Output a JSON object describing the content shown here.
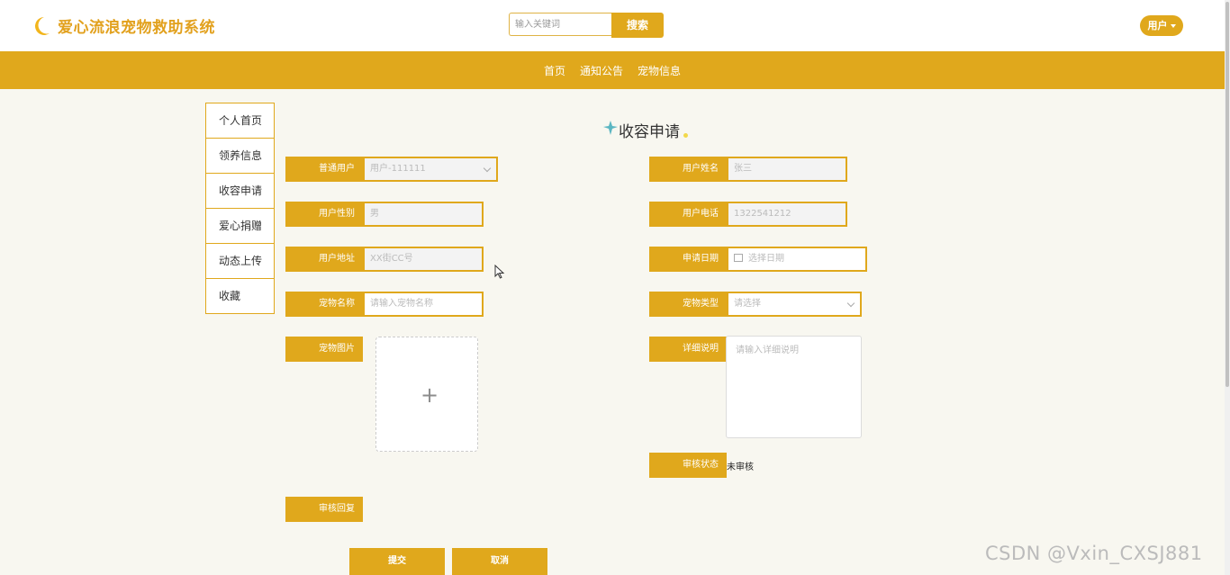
{
  "app": {
    "title": "爱心流浪宠物救助系统"
  },
  "header": {
    "search_placeholder": "输入关键词",
    "search_button": "搜索",
    "user_menu": "用户"
  },
  "nav": {
    "items": [
      "首页",
      "通知公告",
      "宠物信息"
    ]
  },
  "sidebar": {
    "items": [
      "个人首页",
      "领养信息",
      "收容申请",
      "爱心捐赠",
      "动态上传",
      "收藏"
    ]
  },
  "page": {
    "title": "收容申请"
  },
  "form": {
    "user_label": "普通用户",
    "user_value": "用户-111111",
    "name_label": "用户姓名",
    "name_value": "张三",
    "gender_label": "用户性别",
    "gender_value": "男",
    "phone_label": "用户电话",
    "phone_value": "1322541212",
    "address_label": "用户地址",
    "address_value": "XX街CC号",
    "date_label": "申请日期",
    "date_placeholder": "选择日期",
    "pet_name_label": "宠物名称",
    "pet_name_placeholder": "请输入宠物名称",
    "pet_type_label": "宠物类型",
    "pet_type_placeholder": "请选择",
    "pet_image_label": "宠物图片",
    "upload_icon": "plus-icon",
    "detail_label": "详细说明",
    "detail_placeholder": "请输入详细说明",
    "review_status_label": "审核状态",
    "review_status_value": "未审核",
    "review_reply_label": "审核回复",
    "submit_button": "提交",
    "cancel_button": "取消"
  },
  "watermark": "CSDN @Vxin_CXSJ881",
  "colors": {
    "accent": "#e0a81c",
    "background": "#f8f7f0"
  }
}
